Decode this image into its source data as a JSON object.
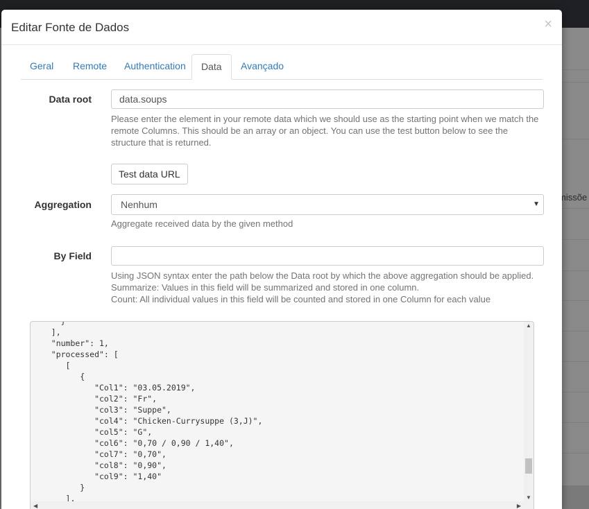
{
  "background": {
    "partial_header_text": "missõe"
  },
  "modal": {
    "title": "Editar Fonte de Dados",
    "close_symbol": "×"
  },
  "tabs": [
    {
      "label": "Geral"
    },
    {
      "label": "Remote"
    },
    {
      "label": "Authentication"
    },
    {
      "label": "Data",
      "active": true
    },
    {
      "label": "Avançado"
    }
  ],
  "data_root": {
    "label": "Data root",
    "value": "data.soups",
    "help": "Please enter the element in your remote data which we should use as the starting point when we match the remote Columns. This should be an array or an object. You can use the test button below to see the structure that is returned."
  },
  "test_button": {
    "label": "Test data URL"
  },
  "aggregation": {
    "label": "Aggregation",
    "selected": "Nenhum",
    "help": "Aggregate received data by the given method"
  },
  "by_field": {
    "label": "By Field",
    "value": "",
    "help_lines": [
      "Using JSON syntax enter the path below the Data root by which the above aggregation should be applied.",
      "Summarize: Values in this field will be summarized and stored in one column.",
      "Count: All individual values in this field will be counted and stored in one Column for each value"
    ]
  },
  "json_output": {
    "lines": [
      "     }",
      "   ],",
      "   \"number\": 1,",
      "   \"processed\": [",
      "      [",
      "         {",
      "            \"Col1\": \"03.05.2019\",",
      "            \"col2\": \"Fr\",",
      "            \"col3\": \"Suppe\",",
      "            \"col4\": \"Chicken-Currysuppe (3,J)\",",
      "            \"col5\": \"G\",",
      "            \"col6\": \"0,70 / 0,90 / 1,40\",",
      "            \"col7\": \"0,70\",",
      "            \"col8\": \"0,90\",",
      "            \"col9\": \"1,40\"",
      "         }",
      "      ],"
    ]
  }
}
